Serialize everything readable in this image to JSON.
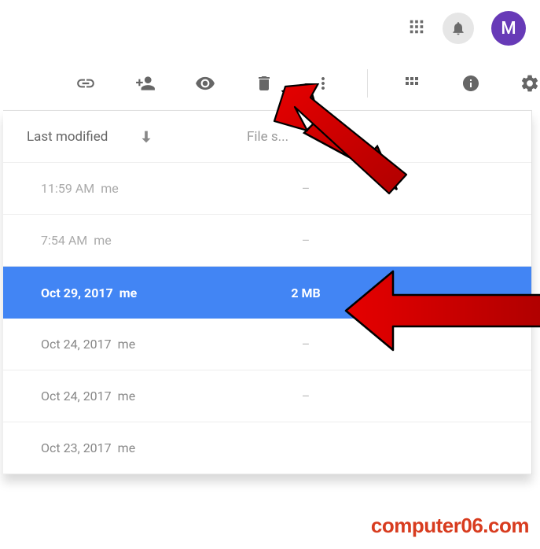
{
  "header": {
    "avatar_initial": "M"
  },
  "toolbar": {
    "icons": {
      "link": "link-icon",
      "share": "share-user-icon",
      "preview": "eye-icon",
      "remove": "trash-icon",
      "more": "more-vert-icon",
      "view": "grid-view-icon",
      "details": "info-icon",
      "settings": "gear-icon"
    }
  },
  "columns": {
    "modified_label": "Last modified",
    "size_label": "File s..."
  },
  "rows": [
    {
      "time": "11:59 AM",
      "owner": "me",
      "size": "–",
      "selected": false,
      "muted": true
    },
    {
      "time": "7:54 AM",
      "owner": "me",
      "size": "–",
      "selected": false,
      "muted": true
    },
    {
      "time": "Oct 29, 2017",
      "owner": "me",
      "size": "2 MB",
      "selected": true,
      "muted": false
    },
    {
      "time": "Oct 24, 2017",
      "owner": "me",
      "size": "–",
      "selected": false,
      "muted": false
    },
    {
      "time": "Oct 24, 2017",
      "owner": "me",
      "size": "–",
      "selected": false,
      "muted": false
    },
    {
      "time": "Oct 23, 2017",
      "owner": "me",
      "size": "",
      "selected": false,
      "muted": false
    }
  ],
  "watermark": "computer06.com"
}
